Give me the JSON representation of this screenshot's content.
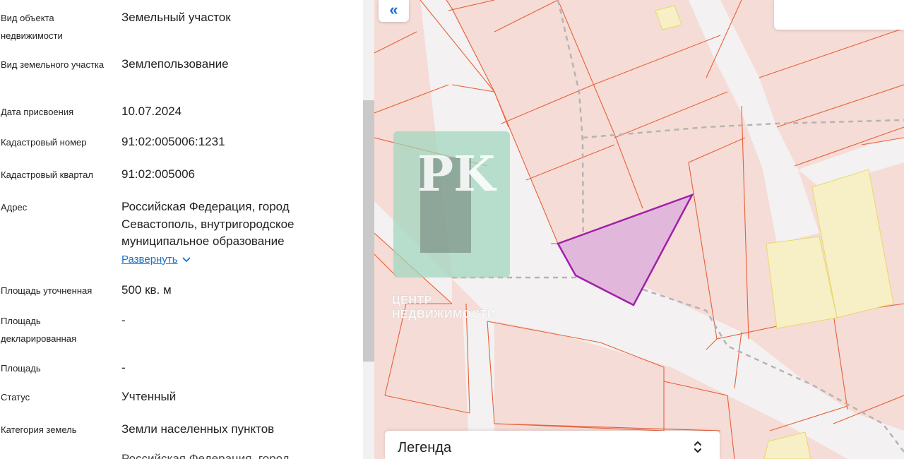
{
  "details": [
    {
      "label": "Вид объекта недвижимости",
      "value": "Земельный участок"
    },
    {
      "label": "Вид земельного участка",
      "value": "Землепользование"
    },
    {
      "label": "Дата присвоения",
      "value": "10.07.2024"
    },
    {
      "label": "Кадастровый номер",
      "value": "91:02:005006:1231"
    },
    {
      "label": "Кадастровый квартал",
      "value": "91:02:005006"
    },
    {
      "label": "Адрес",
      "value": "Российская Федерация, город Севастополь, внутригородское муниципальное образование"
    },
    {
      "label": "Площадь уточненная",
      "value": "500 кв. м"
    },
    {
      "label": "Площадь декларированная",
      "value": "-"
    },
    {
      "label": "Площадь",
      "value": "-"
    },
    {
      "label": "Статус",
      "value": "Учтенный"
    },
    {
      "label": "Категория земель",
      "value": "Земли населенных пунктов"
    }
  ],
  "expand_link": "Развернуть",
  "truncated_value": "Российская Федерация, город",
  "map": {
    "collapse_icon": "double-chevron-left-icon",
    "legend_label": "Легенда",
    "legend_icon": "chevron-up-down-icon",
    "watermark_letters": "PK",
    "watermark_line1": "ЦЕНТР",
    "watermark_line2": "НЕДВИЖИМОСТИ",
    "colors": {
      "parcel_fill": "#f5dcd6",
      "parcel_border": "#e8603a",
      "road": "#f3f1f1",
      "selected_fill": "#e2b7dc",
      "selected_border": "#a020a8",
      "yellow": "#f7f0c6"
    }
  }
}
